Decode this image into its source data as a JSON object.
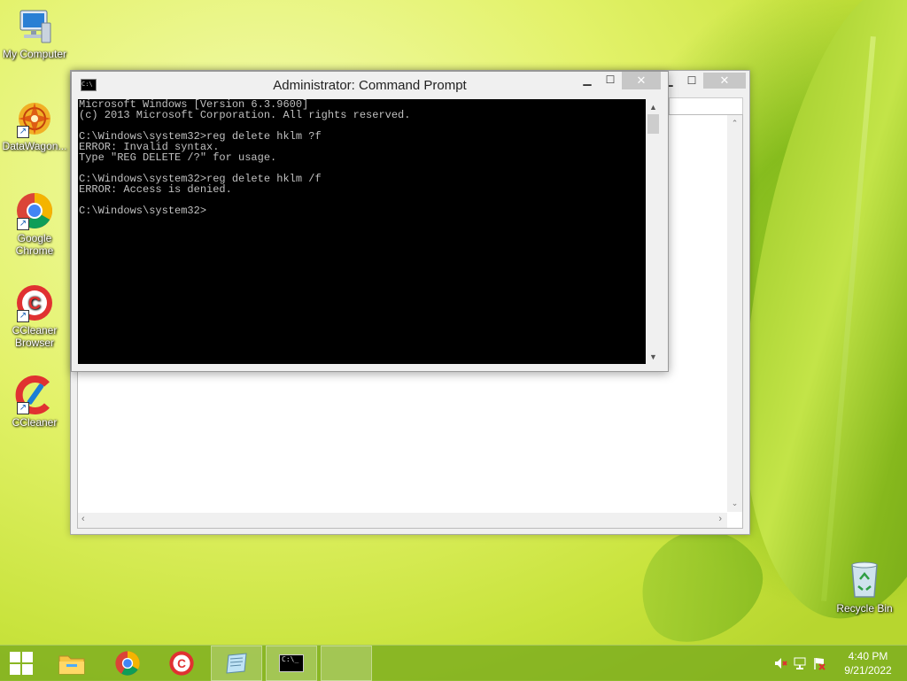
{
  "desktop": {
    "icons": [
      {
        "label": "My Computer",
        "icon": "computer-icon"
      },
      {
        "label": "DataWagon...",
        "icon": "datawagon-icon"
      },
      {
        "label": "Google Chrome",
        "icon": "chrome-icon"
      },
      {
        "label": "CCleaner Browser",
        "icon": "ccleaner-browser-icon"
      },
      {
        "label": "CCleaner",
        "icon": "ccleaner-icon"
      }
    ],
    "recycle_bin": {
      "label": "Recycle Bin",
      "icon": "recycle-bin-icon"
    }
  },
  "cmd_window": {
    "title": "Administrator: Command Prompt",
    "lines": [
      "Microsoft Windows [Version 6.3.9600]",
      "(c) 2013 Microsoft Corporation. All rights reserved.",
      "",
      "C:\\Windows\\system32>reg delete hklm ?f",
      "ERROR: Invalid syntax.",
      "Type \"REG DELETE /?\" for usage.",
      "",
      "C:\\Windows\\system32>reg delete hklm /f",
      "ERROR: Access is denied.",
      "",
      "C:\\Windows\\system32>"
    ]
  },
  "taskbar": {
    "items": [
      "start",
      "file-explorer",
      "chrome",
      "ccleaner-browser",
      "notepad",
      "command-prompt",
      "blank"
    ],
    "clock": {
      "time": "4:40 PM",
      "date": "9/21/2022"
    }
  },
  "colors": {
    "console_bg": "#000000",
    "console_text": "#c0c0c0",
    "taskbar": "#78aa1e"
  }
}
